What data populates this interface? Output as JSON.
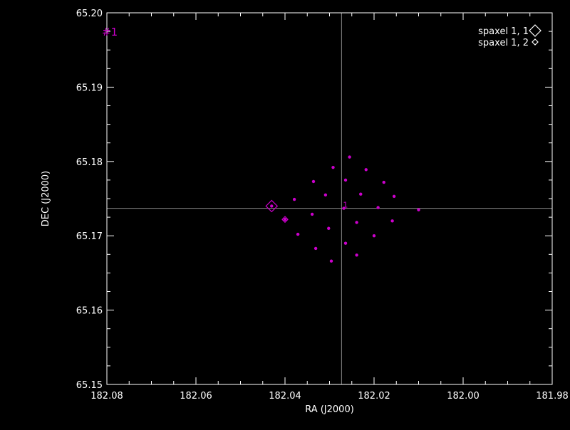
{
  "chart_data": {
    "type": "scatter",
    "xlabel": "RA (J2000)",
    "ylabel": "DEC (J2000)",
    "xlim": [
      182.08,
      181.98
    ],
    "ylim": [
      65.15,
      65.2
    ],
    "x_ticks": [
      "182.08",
      "182.06",
      "182.04",
      "182.02",
      "182.00",
      "181.98"
    ],
    "y_ticks": [
      "65.15",
      "65.16",
      "65.17",
      "65.18",
      "65.19",
      "65.20"
    ],
    "plot_label": "#1",
    "center_label": "1",
    "crosshair": {
      "x": 182.0273,
      "y": 65.1737
    },
    "points": {
      "x": [
        182.0255,
        182.0292,
        182.0218,
        182.0336,
        182.0264,
        182.0178,
        182.0379,
        182.0309,
        182.023,
        182.0155,
        182.043,
        182.0268,
        182.0191,
        182.01,
        182.0339,
        182.0239,
        182.0159,
        182.0371,
        182.0302,
        182.04,
        182.0264,
        182.02,
        182.0331,
        182.0239,
        182.0296
      ],
      "y": [
        65.1806,
        65.1792,
        65.1789,
        65.1773,
        65.1775,
        65.1772,
        65.1749,
        65.1755,
        65.1756,
        65.1753,
        65.174,
        65.1737,
        65.1738,
        65.1735,
        65.1729,
        65.1718,
        65.172,
        65.1702,
        65.171,
        65.1722,
        65.169,
        65.17,
        65.1683,
        65.1674,
        65.1666
      ]
    },
    "highlights": [
      {
        "name": "spaxel 1, 1",
        "x": 182.043,
        "y": 65.174,
        "size": 8,
        "color": "#cc00cc"
      },
      {
        "name": "spaxel 1, 2",
        "x": 182.04,
        "y": 65.1722,
        "size": 4,
        "color": "#cc00cc"
      }
    ],
    "legend": [
      {
        "label": "spaxel 1, 1",
        "size": 8
      },
      {
        "label": "spaxel 1, 2",
        "size": 4
      }
    ],
    "legend_position": "top-right",
    "colors": {
      "background": "#000000",
      "axes": "#ffffff",
      "points": "#cc00cc",
      "crosshair": "#888888"
    },
    "grid": false
  }
}
